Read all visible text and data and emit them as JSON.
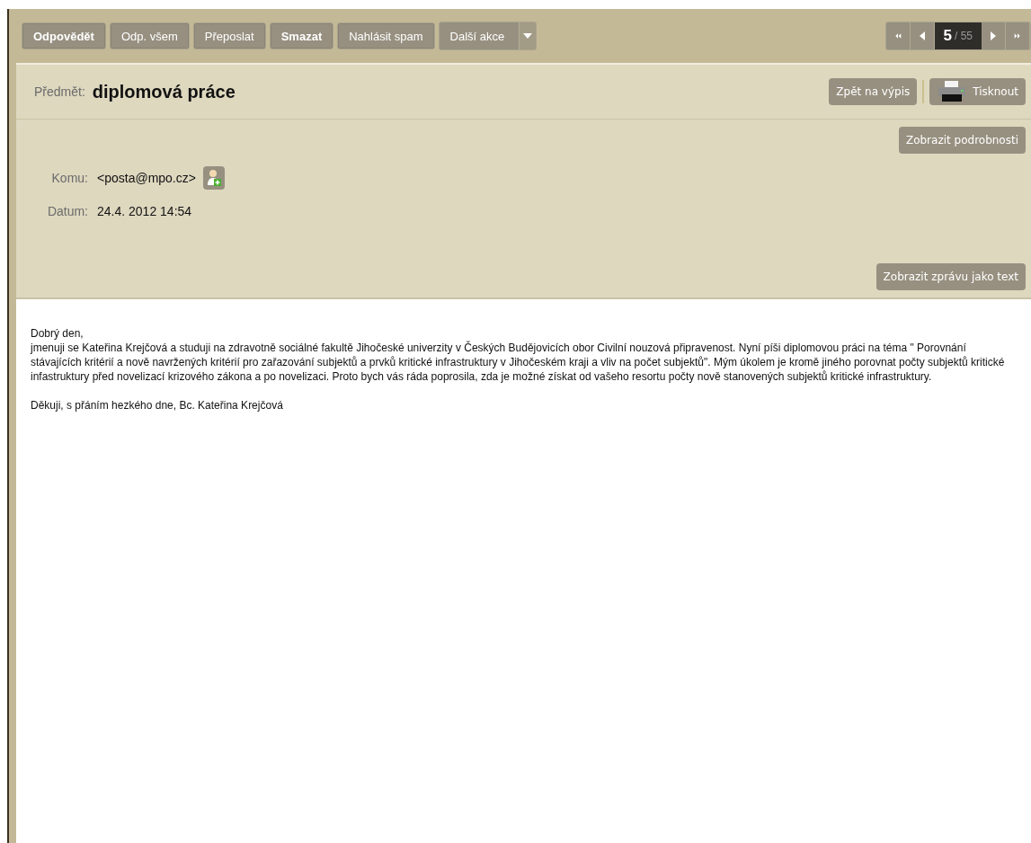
{
  "toolbar": {
    "actions": [
      {
        "label": "Odpovědět",
        "bold": true
      },
      {
        "label": "Odp. všem",
        "bold": false
      },
      {
        "label": "Přeposlat",
        "bold": false
      },
      {
        "label": "Smazat",
        "bold": true
      },
      {
        "label": "Nahlásit spam",
        "bold": false
      }
    ],
    "more_menu": {
      "label": "Další akce"
    },
    "pager": {
      "current": "5",
      "total": "/ 55"
    }
  },
  "subject": {
    "label": "Předmět:",
    "value": "diplomová práce",
    "back_button": "Zpět na výpis",
    "print_button": "Tisknout"
  },
  "header": {
    "details_button": "Zobrazit podrobnosti",
    "fields": [
      {
        "label": "Komu:",
        "value": "<posta@mpo.cz>",
        "kind": "address"
      },
      {
        "label": "Datum:",
        "value": "24.4. 2012 14:54",
        "kind": "date"
      }
    ],
    "text_button": "Zobrazit zprávu jako text"
  },
  "body": {
    "greeting": "Dobrý den,",
    "paragraph": "jmenuji se Kateřina Krejčová a studuji na zdravotně sociálné fakultě Jihočeské univerzity v Českých Budějovicích obor Civilní nouzová připravenost. Nyní píši diplomovou práci na téma \" Porovnání stávajících kritérií a nově navržených kritérií pro zařazování subjektů a prvků kritické infrastruktury v Jihočeském kraji a vliv na počet subjektů\". Mým úkolem je kromě jiného porovnat počty subjektů kritické infastruktury před novelizací krizového zákona a po novelizaci. Proto bych vás ráda poprosila, zda je možné získat od vašeho resortu počty nově stanovených subjektů kritické infrastruktury.",
    "closing": "Děkuji, s přáním hezkého dne, Bc. Kateřina Krejčová"
  }
}
